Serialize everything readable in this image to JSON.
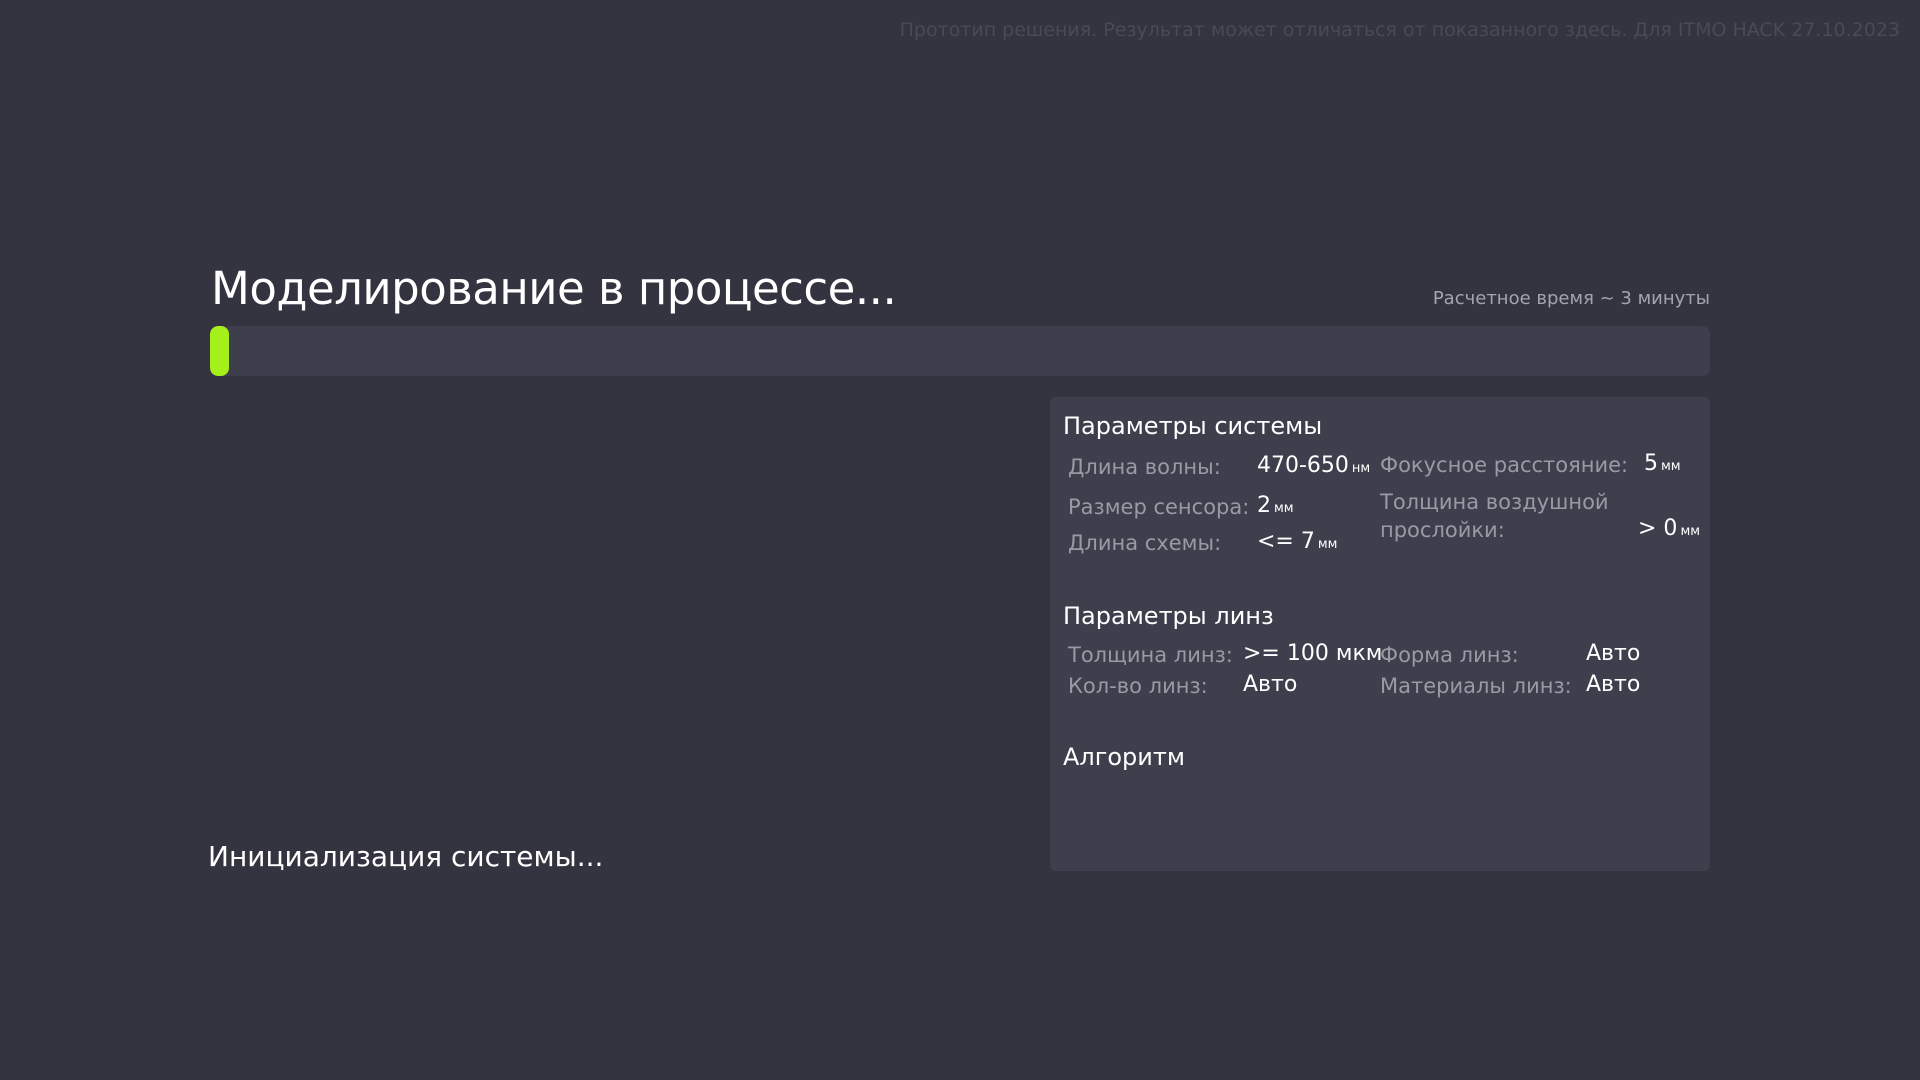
{
  "disclaimer": "Прототип решения. Результат может отличаться от показанного здесь. Для ITMO HACK 27.10.2023",
  "header": {
    "title": "Моделирование в процессе...",
    "eta": "Расчетное время ~ 3 минуты"
  },
  "progress": {
    "percent": 1.3,
    "color": "#a3f01a"
  },
  "status": "Инициализация системы...",
  "system_params": {
    "title": "Параметры системы",
    "wavelength": {
      "label": "Длина волны:",
      "value": "470-650",
      "unit": "нм"
    },
    "focal_length": {
      "label": "Фокусное расстояние:",
      "value": "5",
      "unit": "мм"
    },
    "sensor_size": {
      "label": "Размер сенсора:",
      "value": "2",
      "unit": "мм"
    },
    "air_gap": {
      "label_line1": "Толщина воздушной",
      "label_line2": "прослойки:",
      "value": "> 0",
      "unit": "мм"
    },
    "scheme_length": {
      "label": "Длина схемы:",
      "value": "<= 7",
      "unit": "мм"
    }
  },
  "lens_params": {
    "title": "Параметры линз",
    "thickness": {
      "label": "Толщина линз:",
      "value": ">= 100 мкм"
    },
    "shape": {
      "label": "Форма линз:",
      "value": "Авто"
    },
    "count": {
      "label": "Кол-во линз:",
      "value": "Авто"
    },
    "materials": {
      "label": "Материалы линз:",
      "value": "Авто"
    }
  },
  "algorithm": {
    "title": "Алгоритм"
  },
  "colors": {
    "background": "#343441",
    "panel": "#3e3f4c",
    "accent": "#a3f01a"
  }
}
